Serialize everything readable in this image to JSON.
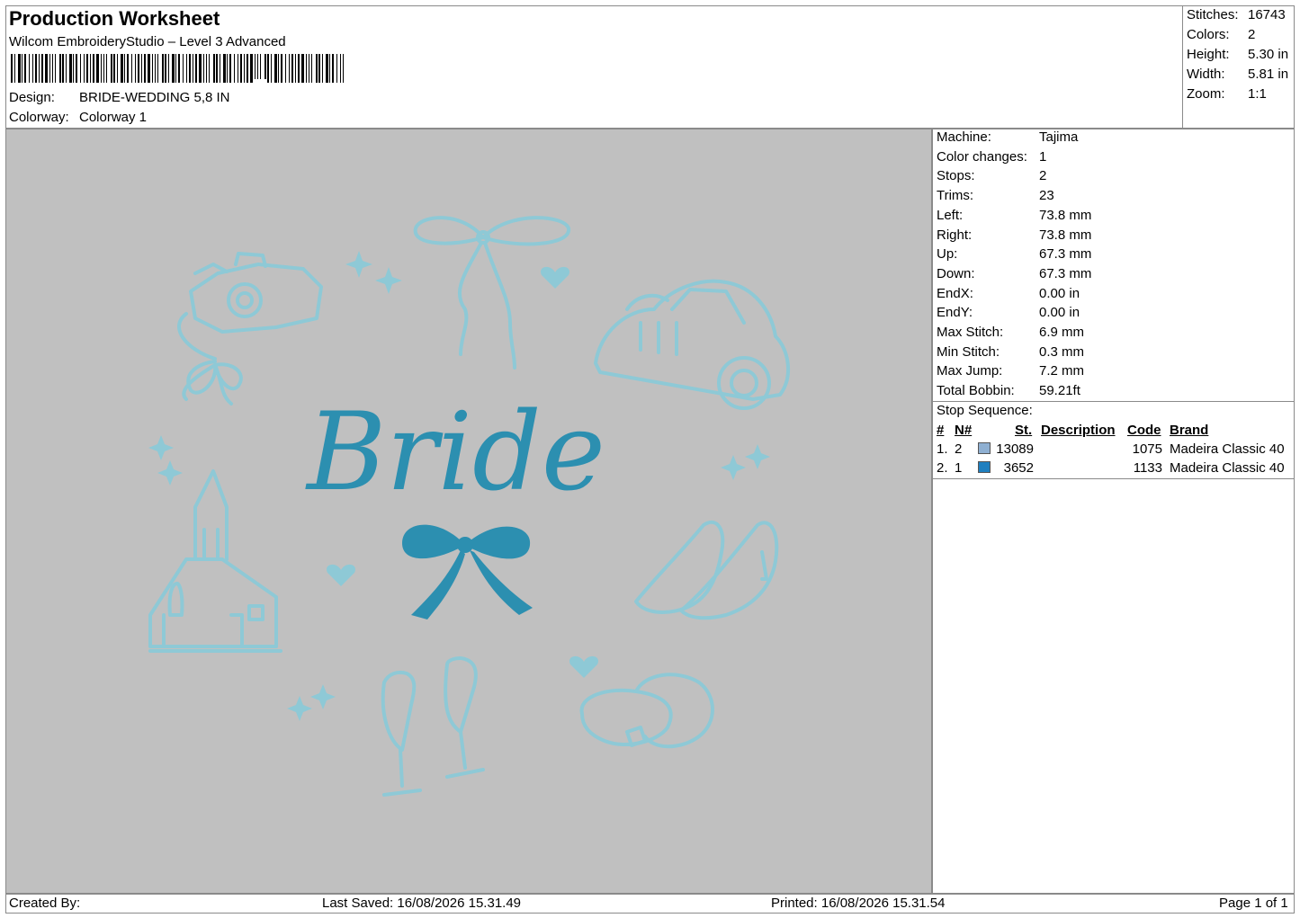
{
  "header": {
    "title": "Production Worksheet",
    "subtitle": "Wilcom EmbroideryStudio – Level 3 Advanced",
    "design_label": "Design:",
    "design_value": "BRIDE-WEDDING 5,8 IN",
    "colorway_label": "Colorway:",
    "colorway_value": "Colorway 1"
  },
  "stats": [
    {
      "label": "Stitches:",
      "value": "16743"
    },
    {
      "label": "Colors:",
      "value": "2"
    },
    {
      "label": "Height:",
      "value": "5.30 in"
    },
    {
      "label": "Width:",
      "value": "5.81 in"
    },
    {
      "label": "Zoom:",
      "value": "1:1"
    }
  ],
  "machine": [
    {
      "label": "Machine:",
      "value": "Tajima"
    },
    {
      "label": "Color changes:",
      "value": "1"
    },
    {
      "label": "Stops:",
      "value": "2"
    },
    {
      "label": "Trims:",
      "value": "23"
    },
    {
      "label": "Left:",
      "value": "73.8 mm"
    },
    {
      "label": "Right:",
      "value": "73.8 mm"
    },
    {
      "label": "Up:",
      "value": "67.3 mm"
    },
    {
      "label": "Down:",
      "value": "67.3 mm"
    },
    {
      "label": "EndX:",
      "value": "0.00 in"
    },
    {
      "label": "EndY:",
      "value": "0.00 in"
    },
    {
      "label": "Max Stitch:",
      "value": "6.9 mm"
    },
    {
      "label": "Min Stitch:",
      "value": "0.3 mm"
    },
    {
      "label": "Max Jump:",
      "value": "7.2 mm"
    },
    {
      "label": "Total Bobbin:",
      "value": "59.21ft"
    }
  ],
  "sequence": {
    "title": "Stop Sequence:",
    "headers": {
      "num": "#",
      "n": "N#",
      "st": "St.",
      "desc": "Description",
      "code": "Code",
      "brand": "Brand"
    },
    "rows": [
      {
        "num": "1.",
        "n": "2",
        "color": "#8fb0d2",
        "st": "13089",
        "desc": "",
        "code": "1075",
        "brand": "Madeira Classic 40"
      },
      {
        "num": "2.",
        "n": "1",
        "color": "#1f7fbf",
        "st": "3652",
        "desc": "",
        "code": "1133",
        "brand": "Madeira Classic 40"
      }
    ]
  },
  "design_text": "Bride",
  "colors": {
    "canvas": "#c0c0c0",
    "outline_thread": "#8ec9d6",
    "fill_thread": "#2c8fb0"
  },
  "footer": {
    "created_by": "Created By:",
    "last_saved": "Last Saved: 16/08/2026 15.31.49",
    "printed": "Printed: 16/08/2026 15.31.54",
    "page": "Page 1 of 1"
  }
}
